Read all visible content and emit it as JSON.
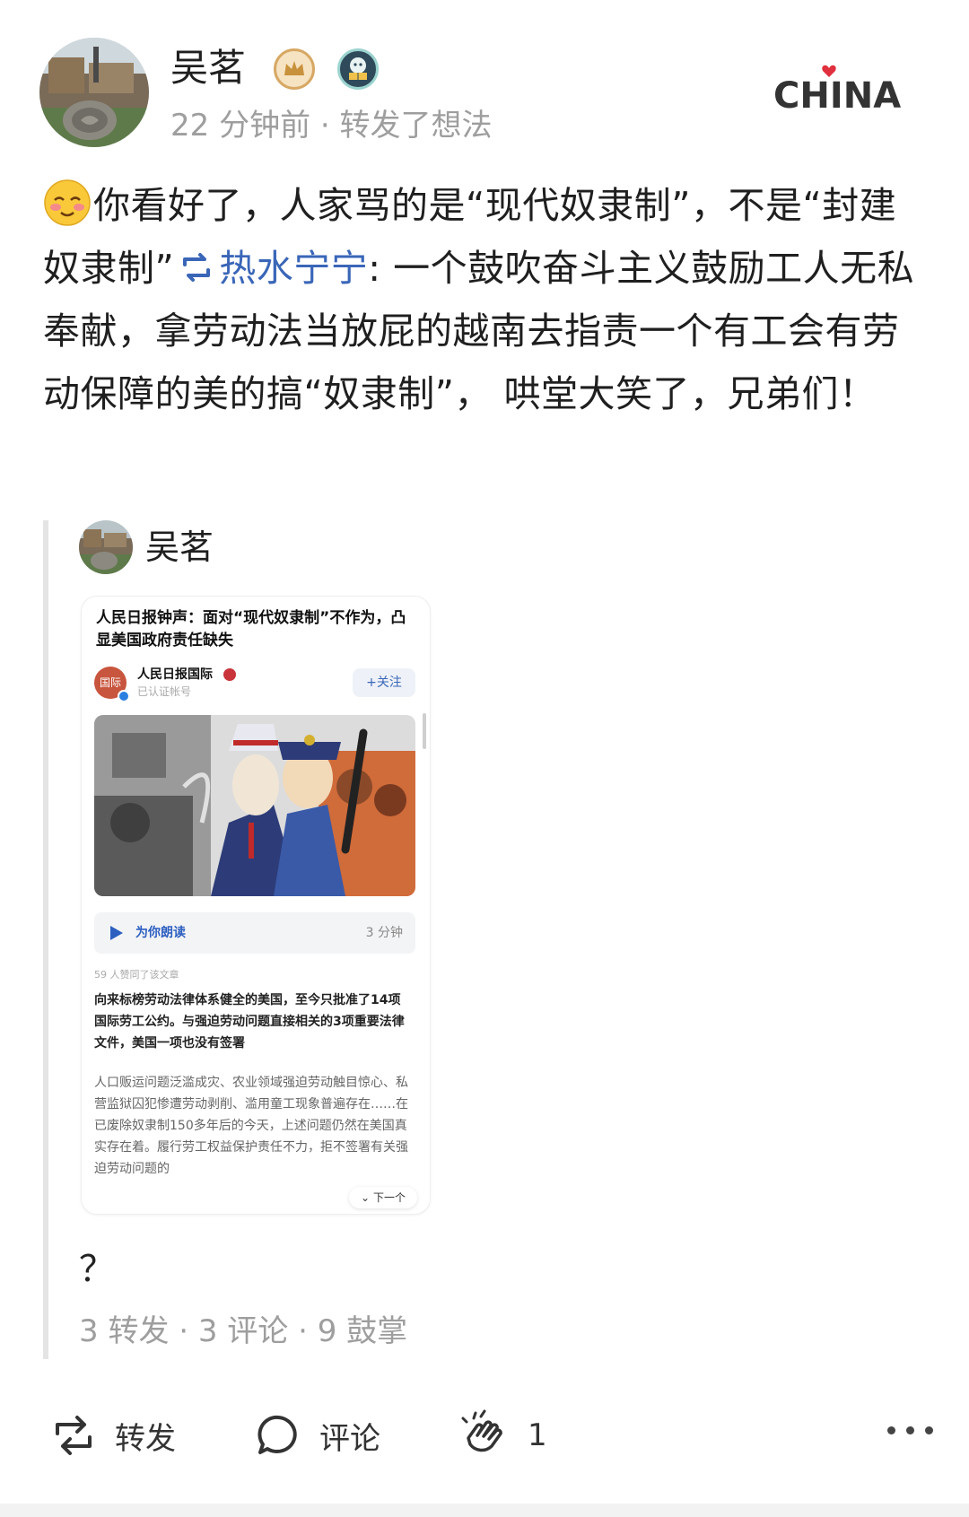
{
  "post": {
    "author": "吴茗",
    "meta": "22 分钟前 · 转发了想法",
    "brand": "CHINA",
    "text_part1": "你看好了，人家骂的是“现代奴隶制”，不是“封建奴隶制”",
    "repost_user": "热水宁宁",
    "text_part2": ": 一个鼓吹奋斗主义鼓励工人无私奉献，拿劳动法当放屁的越南去指责一个有工会有劳动保障的美的搞“奴隶制”， 哄堂大笑了，兄弟们！"
  },
  "quoted": {
    "author": "吴茗",
    "comment": "？",
    "stats": "3 转发 · 3 评论 · 9 鼓掌",
    "screenshot": {
      "title": "人民日报钟声：面对“现代奴隶制”不作为，凸显美国政府责任缺失",
      "account_name": "人民日报国际",
      "account_logo": "国际",
      "account_sub": "已认证帐号",
      "follow_label": "+关注",
      "listen_label": "为你朗读",
      "listen_time": "3 分钟",
      "likes": "59 人赞同了该文章",
      "lead": "向来标榜劳动法律体系健全的美国，至今只批准了14项国际劳工公约。与强迫劳动问题直接相关的3项重要法律文件，美国一项也没有签署",
      "body": "人口贩运问题泛滥成灾、农业领域强迫劳动触目惊心、私营监狱囚犯惨遭劳动剥削、滥用童工现象普遍存在……在已废除奴隶制150多年后的今天，上述问题仍然在美国真实存在着。履行劳工权益保护责任不力，拒不签署有关强迫劳动问题的",
      "next_label": "下一个"
    }
  },
  "actions": {
    "repost": "转发",
    "comment": "评论",
    "clap_count": "1"
  },
  "icons": {
    "emoji": "blushing-face-icon",
    "repost": "repost-arrows-icon",
    "comment": "speech-bubble-icon",
    "clap": "clapping-hands-icon",
    "more": "more-dots-icon",
    "crown": "crown-badge-icon",
    "book": "reading-badge-icon"
  },
  "colors": {
    "link": "#3a66b8",
    "meta_gray": "#9e9e9e",
    "brand_red": "#e0303e"
  }
}
